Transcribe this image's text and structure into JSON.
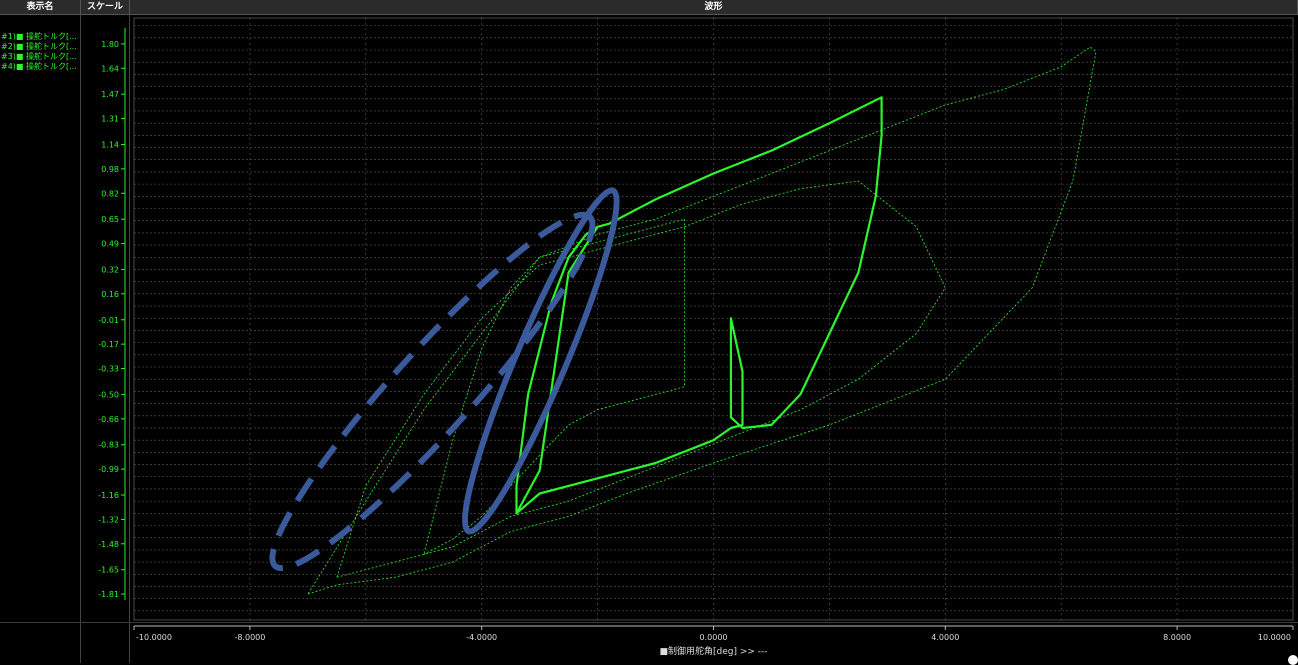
{
  "header": {
    "col_name": "表示名",
    "col_scale": "スケール",
    "col_wave": "波形"
  },
  "legend": [
    "#1)■ 操舵トルク[...",
    "#2)■ 操舵トルク[...",
    "#3)■ 操舵トルク[...",
    "#4)■ 操舵トルク[..."
  ],
  "colors": {
    "series": "#2df52d",
    "annotation": "#3a5a9c",
    "grid": "#5a5a5a",
    "background": "#000000"
  },
  "chart_data": {
    "type": "line",
    "xlabel": "■制御用舵角[deg] >> ---",
    "xlim": [
      -10,
      10
    ],
    "ylim": [
      -1.98,
      1.97
    ],
    "y_ticks": [
      "1.80",
      "1.64",
      "1.47",
      "1.31",
      "1.14",
      "0.98",
      "0.82",
      "0.65",
      "0.49",
      "0.32",
      "0.16",
      "-0.01",
      "-0.17",
      "-0.33",
      "-0.50",
      "-0.66",
      "-0.83",
      "-0.99",
      "-1.16",
      "-1.32",
      "-1.48",
      "-1.65",
      "-1.81"
    ],
    "x_ticks": [
      "-10.0000",
      "-8.0000",
      "-4.0000",
      "0.0000",
      "4.0000",
      "8.0000",
      "10.0000"
    ],
    "series": [
      {
        "style": "bold",
        "x": [
          -3.4,
          -3.0,
          -2.5,
          -2.0,
          -1.8,
          -1.0,
          0.0,
          1.0,
          2.0,
          2.9,
          2.9,
          2.8,
          2.5,
          2.0,
          1.5,
          1.0,
          0.5,
          0.3,
          0.3,
          0.5,
          0.5,
          0.3,
          0.0,
          -1.0,
          -2.0,
          -3.0,
          -3.4,
          -3.4,
          -3.2,
          -2.8,
          -2.5,
          -2.2,
          -2.0,
          -1.8
        ],
        "y": [
          -1.28,
          -1.0,
          0.3,
          0.6,
          0.62,
          0.78,
          0.95,
          1.1,
          1.28,
          1.45,
          1.2,
          0.8,
          0.3,
          -0.1,
          -0.5,
          -0.7,
          -0.72,
          -0.65,
          0.0,
          -0.35,
          -0.7,
          -0.72,
          -0.8,
          -0.95,
          -1.05,
          -1.15,
          -1.28,
          -1.1,
          -0.5,
          0.1,
          0.4,
          0.55,
          0.6,
          0.62
        ]
      },
      {
        "style": "thin",
        "x": [
          -7.0,
          -6.5,
          -5.5,
          -4.5,
          -3.5,
          -2.5,
          -1.5,
          0.0,
          2.0,
          4.0,
          5.5,
          6.2,
          6.6,
          6.5,
          6.0,
          5.0,
          4.0,
          3.0,
          2.0,
          1.0,
          0.0,
          -1.0,
          -2.0,
          -3.0,
          -4.0,
          -5.0,
          -6.0,
          -7.0
        ],
        "y": [
          -1.81,
          -1.75,
          -1.7,
          -1.6,
          -1.4,
          -1.3,
          -1.15,
          -0.95,
          -0.7,
          -0.4,
          0.2,
          0.9,
          1.75,
          1.78,
          1.65,
          1.5,
          1.4,
          1.25,
          1.1,
          0.95,
          0.8,
          0.65,
          0.55,
          0.4,
          -0.1,
          -0.6,
          -1.2,
          -1.81
        ]
      },
      {
        "style": "thin",
        "x": [
          -6.5,
          -5.5,
          -4.5,
          -3.5,
          -2.5,
          -1.5,
          -0.5,
          0.5,
          1.5,
          2.5,
          3.5,
          4.0,
          3.5,
          2.5,
          1.5,
          0.5,
          -0.5,
          -1.5,
          -2.5,
          -3.0,
          -4.0,
          -5.0,
          -6.0,
          -6.5
        ],
        "y": [
          -1.7,
          -1.6,
          -1.5,
          -1.3,
          -1.2,
          -1.05,
          -0.9,
          -0.75,
          -0.6,
          -0.4,
          -0.1,
          0.2,
          0.6,
          0.9,
          0.85,
          0.75,
          0.6,
          0.5,
          0.4,
          0.35,
          0.0,
          -0.5,
          -1.1,
          -1.7
        ]
      },
      {
        "style": "thin",
        "x": [
          -5.0,
          -4.5,
          -4.0,
          -3.5,
          -3.0,
          -2.5,
          -2.0,
          -1.5,
          -1.0,
          -0.5,
          -0.5,
          -1.0,
          -1.5,
          -2.0,
          -2.5,
          -3.0,
          -3.5,
          -4.0,
          -4.5,
          -5.0
        ],
        "y": [
          -1.55,
          -1.45,
          -1.3,
          -1.1,
          -0.9,
          -0.7,
          -0.6,
          -0.55,
          -0.5,
          -0.45,
          0.65,
          0.6,
          0.55,
          0.5,
          0.45,
          0.4,
          0.2,
          -0.2,
          -0.8,
          -1.55
        ]
      }
    ]
  }
}
